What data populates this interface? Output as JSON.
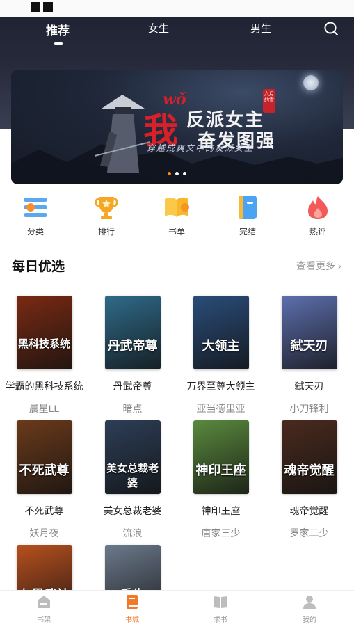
{
  "nav": {
    "tabs": [
      {
        "label": "推荐",
        "active": true
      },
      {
        "label": "女生",
        "active": false
      },
      {
        "label": "男生",
        "active": false
      }
    ]
  },
  "banner": {
    "pinyin": "wǒ",
    "big_char": "我",
    "line1": "反派女主",
    "line2": "奋发图强",
    "subtitle": "穿越成爽文中的反派女主",
    "seal_text": "六月的雪",
    "page_count": 3,
    "active_index": 0
  },
  "categories": [
    {
      "label": "分类",
      "icon": "category-icon"
    },
    {
      "label": "排行",
      "icon": "trophy-icon"
    },
    {
      "label": "书单",
      "icon": "book-list-icon"
    },
    {
      "label": "完结",
      "icon": "completed-icon"
    },
    {
      "label": "热评",
      "icon": "hot-comment-icon"
    }
  ],
  "section": {
    "title": "每日优选",
    "more_label": "查看更多 ›"
  },
  "books": [
    {
      "title": "学霸的黑科技系统",
      "author": "晨星LL",
      "cover_text": "黑科技系统",
      "cover_color": "#7a2a12"
    },
    {
      "title": "丹武帝尊",
      "author": "暗点",
      "cover_text": "丹武帝尊",
      "cover_color": "#2f6b8a"
    },
    {
      "title": "万界至尊大领主",
      "author": "亚当德里亚",
      "cover_text": "大领主",
      "cover_color": "#2a4d7a"
    },
    {
      "title": "弑天刃",
      "author": "小刀锋利",
      "cover_text": "弑天刃",
      "cover_color": "#5d6fae"
    },
    {
      "title": "不死武尊",
      "author": "妖月夜",
      "cover_text": "不死武尊",
      "cover_color": "#6b3a1a"
    },
    {
      "title": "美女总裁老婆",
      "author": "流浪",
      "cover_text": "美女总裁老婆",
      "cover_color": "#2d3e57"
    },
    {
      "title": "神印王座",
      "author": "唐家三少",
      "cover_text": "神印王座",
      "cover_color": "#5a8a3e"
    },
    {
      "title": "魂帝觉醒",
      "author": "罗家二少",
      "cover_text": "魂帝觉醒",
      "cover_color": "#4a2a1e"
    },
    {
      "title": "",
      "author": "",
      "cover_text": "七界武神",
      "cover_color": "#b8501e"
    },
    {
      "title": "",
      "author": "",
      "cover_text": "重生",
      "cover_color": "#6c7a8c"
    }
  ],
  "tabbar": [
    {
      "label": "书架",
      "icon": "bookshelf-icon",
      "active": false
    },
    {
      "label": "书城",
      "icon": "bookstore-icon",
      "active": true
    },
    {
      "label": "求书",
      "icon": "request-book-icon",
      "active": false
    },
    {
      "label": "我的",
      "icon": "profile-icon",
      "active": false
    }
  ],
  "colors": {
    "accent": "#f07a2a",
    "header_bg": "#262a3b"
  }
}
